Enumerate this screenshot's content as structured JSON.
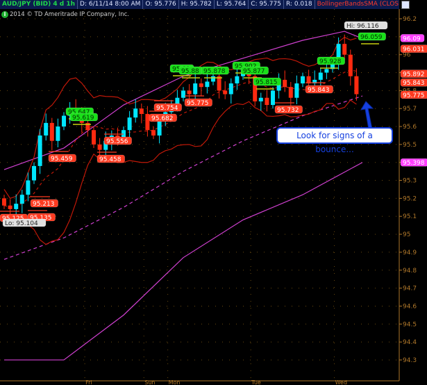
{
  "header": {
    "symbol": "AUD/JPY (BID) 4 d 1h",
    "date": "D: 6/11/14 8:00 AM",
    "open": "O: 95.776",
    "high": "H: 95.782",
    "low": "L: 95.764",
    "close": "C: 95.775",
    "range": "R: 0.018",
    "study": "BollingerBandsSMA (CLOSE, 0, 25, -2.0, ..."
  },
  "copyright": "2014 © TD Ameritrade IP Company, Inc.",
  "annotation": "Look for signs of a bounce...",
  "colors": {
    "up": "#00e5ff",
    "down": "#ff2a10",
    "band": "#c01808",
    "magenta": "#d040d0",
    "label_red": "#ff3a20",
    "label_green": "#19e019",
    "axis": "#b0782a"
  },
  "chart_data": {
    "type": "candlestick",
    "title": "AUD/JPY (BID) 4 d 1h",
    "ylim": [
      94.25,
      96.25
    ],
    "y_ticks": [
      "96.2",
      "96.1",
      "96",
      "95.9",
      "95.8",
      "95.7",
      "95.6",
      "95.5",
      "95.4",
      "95.3",
      "95.2",
      "95.1",
      "95",
      "94.9",
      "94.8",
      "94.7",
      "94.6",
      "94.5",
      "94.4",
      "94.3"
    ],
    "x_ticks": [
      {
        "label": "Fri",
        "index": 13.5
      },
      {
        "label": "Sun",
        "index": 23.4
      },
      {
        "label": "Mon",
        "index": 27.4
      },
      {
        "label": "Tue",
        "index": 41.3
      },
      {
        "label": "Wed",
        "index": 55.3
      }
    ],
    "closes": [
      95.16,
      95.14,
      95.17,
      95.22,
      95.3,
      95.38,
      95.55,
      95.62,
      95.52,
      95.6,
      95.66,
      95.7,
      95.68,
      95.62,
      95.58,
      95.5,
      95.47,
      95.52,
      95.55,
      95.53,
      95.58,
      95.65,
      95.7,
      95.67,
      95.58,
      95.55,
      95.63,
      95.68,
      95.72,
      95.76,
      95.8,
      95.78,
      95.84,
      95.82,
      95.85,
      95.88,
      95.8,
      95.78,
      95.84,
      95.88,
      95.92,
      95.88,
      95.74,
      95.76,
      95.72,
      95.8,
      95.86,
      95.82,
      95.76,
      95.84,
      95.88,
      95.84,
      95.86,
      95.9,
      95.92,
      95.96,
      96.06,
      96.0,
      95.88,
      95.78
    ],
    "first_open": 95.2,
    "outer_upper": [
      [
        0,
        95.36
      ],
      [
        10,
        95.48
      ],
      [
        20,
        95.72
      ],
      [
        30,
        95.88
      ],
      [
        40,
        95.98
      ],
      [
        50,
        96.08
      ],
      [
        57,
        96.13
      ],
      [
        60,
        96.09
      ]
    ],
    "outer_mid": [
      [
        0,
        94.86
      ],
      [
        10,
        94.98
      ],
      [
        20,
        95.15
      ],
      [
        30,
        95.35
      ],
      [
        40,
        95.52
      ],
      [
        50,
        95.66
      ],
      [
        60,
        95.77
      ]
    ],
    "outer_lower": [
      [
        0,
        94.3
      ],
      [
        10,
        94.3
      ],
      [
        20,
        94.55
      ],
      [
        30,
        94.87
      ],
      [
        40,
        95.08
      ],
      [
        50,
        95.22
      ],
      [
        60,
        95.4
      ]
    ],
    "high_labels": [
      "95.647",
      "95.619",
      "95.89",
      "95.88",
      "95.878",
      "95.902",
      "95.877",
      "95.815",
      "95.928",
      "96.059"
    ],
    "low_labels": [
      "95.125",
      "95.213",
      "95.135",
      "95.459",
      "95.458",
      "95.556",
      "95.754",
      "95.682",
      "95.775",
      "95.732",
      "95.843"
    ],
    "hi": "Hi: 96.116",
    "lo": "Lo: 95.104",
    "axis_bubbles": [
      {
        "value": "96.09",
        "kind": "magenta"
      },
      {
        "value": "96.031",
        "kind": "red"
      },
      {
        "value": "95.892",
        "kind": "red"
      },
      {
        "value": "95.843",
        "kind": "red"
      },
      {
        "value": "95.775",
        "kind": "red"
      },
      {
        "value": "95.398",
        "kind": "magenta"
      }
    ]
  }
}
